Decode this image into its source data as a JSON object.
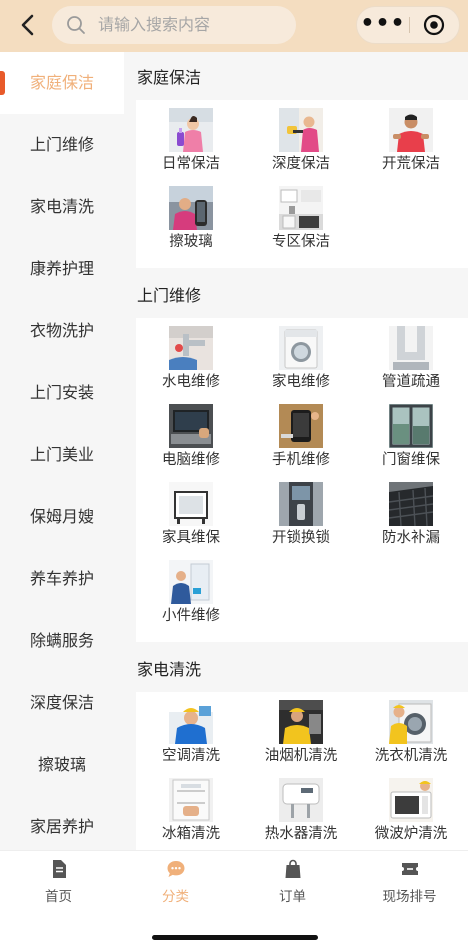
{
  "search": {
    "placeholder": "请输入搜索内容"
  },
  "sidebar": {
    "items": [
      {
        "label": "家庭保洁"
      },
      {
        "label": "上门维修"
      },
      {
        "label": "家电清洗"
      },
      {
        "label": "康养护理"
      },
      {
        "label": "衣物洗护"
      },
      {
        "label": "上门安装"
      },
      {
        "label": "上门美业"
      },
      {
        "label": "保姆月嫂"
      },
      {
        "label": "养车养护"
      },
      {
        "label": "除螨服务"
      },
      {
        "label": "深度保洁"
      },
      {
        "label": "擦玻璃"
      },
      {
        "label": "家居养护"
      }
    ],
    "active_index": 0
  },
  "sections": [
    {
      "title": "家庭保洁",
      "items": [
        {
          "label": "日常保洁",
          "icon": "cleaning-photo"
        },
        {
          "label": "深度保洁",
          "icon": "deep-cleaning-photo"
        },
        {
          "label": "开荒保洁",
          "icon": "worker-photo"
        },
        {
          "label": "擦玻璃",
          "icon": "window-cleaning-photo"
        },
        {
          "label": "专区保洁",
          "icon": "kitchen-photo"
        }
      ]
    },
    {
      "title": "上门维修",
      "items": [
        {
          "label": "水电维修",
          "icon": "plumbing-photo"
        },
        {
          "label": "家电维修",
          "icon": "washing-machine-photo"
        },
        {
          "label": "管道疏通",
          "icon": "pipe-photo"
        },
        {
          "label": "电脑维修",
          "icon": "laptop-photo"
        },
        {
          "label": "手机维修",
          "icon": "phone-repair-photo"
        },
        {
          "label": "门窗维保",
          "icon": "window-photo"
        },
        {
          "label": "家具维保",
          "icon": "furniture-photo"
        },
        {
          "label": "开锁换锁",
          "icon": "lock-photo"
        },
        {
          "label": "防水补漏",
          "icon": "waterproof-photo"
        },
        {
          "label": "小件维修",
          "icon": "small-repair-photo"
        }
      ]
    },
    {
      "title": "家电清洗",
      "items": [
        {
          "label": "空调清洗",
          "icon": "ac-cleaning-photo"
        },
        {
          "label": "油烟机清洗",
          "icon": "hood-cleaning-photo"
        },
        {
          "label": "洗衣机清洗",
          "icon": "washer-cleaning-photo"
        },
        {
          "label": "冰箱清洗",
          "icon": "fridge-cleaning-photo"
        },
        {
          "label": "热水器清洗",
          "icon": "water-heater-photo"
        },
        {
          "label": "微波炉清洗",
          "icon": "microwave-photo"
        }
      ]
    }
  ],
  "nav": [
    {
      "label": "首页",
      "icon": "document-icon"
    },
    {
      "label": "分类",
      "icon": "chat-bubble-icon"
    },
    {
      "label": "订单",
      "icon": "bag-icon"
    },
    {
      "label": "现场排号",
      "icon": "ticket-icon"
    }
  ],
  "colors": {
    "header_bg": "#f4ddc0",
    "accent": "#f0b07a",
    "active_bar": "#e85a2a"
  }
}
